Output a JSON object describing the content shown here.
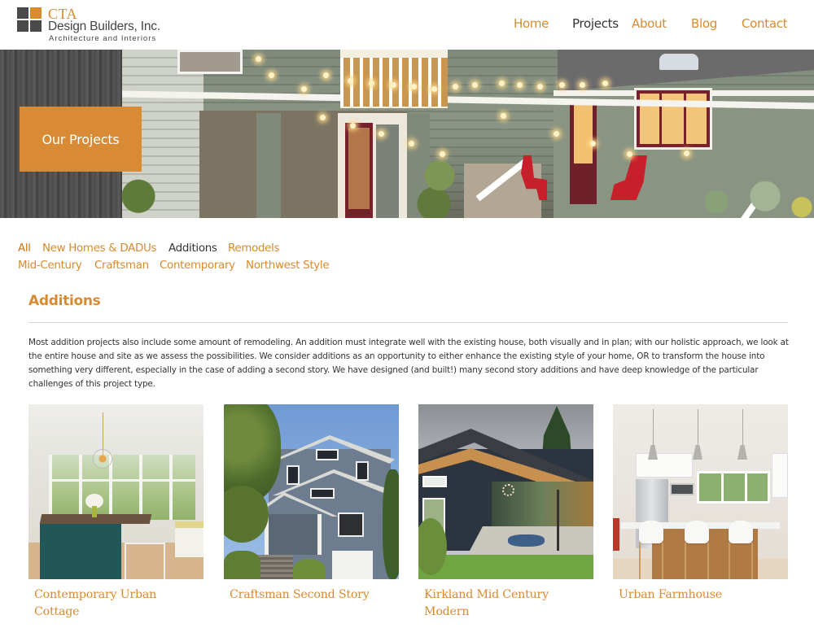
{
  "header": {
    "logo": {
      "brand": "CTA",
      "name": "Design Builders, Inc.",
      "tagline": "Architecture and Interiors"
    },
    "nav": [
      {
        "label": "Home",
        "active": false
      },
      {
        "label": "Projects",
        "active": true
      },
      {
        "label": "About",
        "active": false
      },
      {
        "label": "Blog",
        "active": false
      },
      {
        "label": "Contact",
        "active": false
      }
    ]
  },
  "hero": {
    "badge_label": "Our Projects"
  },
  "filters": {
    "row1": [
      {
        "label": "All"
      },
      {
        "label": "New Homes & DADUs"
      },
      {
        "label": "Additions",
        "current": true
      },
      {
        "label": "Remodels"
      }
    ],
    "row2": [
      {
        "label": "Mid-Century"
      },
      {
        "label": "Craftsman"
      },
      {
        "label": "Contemporary"
      },
      {
        "label": "Northwest Style"
      }
    ]
  },
  "section": {
    "title": "Additions",
    "description": "Most addition projects also include some amount of remodeling. An addition must integrate well with the existing house, both visually and in plan; with our holistic approach, we look at the entire house and site as we assess the possibilities. We consider additions as an opportunity to either enhance the existing style of your home, OR to transform the house into something very different, especially in the case of adding a second story. We have designed (and built!) many second story additions and have deep knowledge of the particular challenges of this project type."
  },
  "projects": [
    {
      "title": "Contemporary Urban Cottage",
      "image": "kitchen-nook-photo"
    },
    {
      "title": "Craftsman Second Story",
      "image": "craftsman-house-photo"
    },
    {
      "title": "Kirkland Mid Century Modern",
      "image": "mid-century-house-photo"
    },
    {
      "title": "Urban Farmhouse",
      "image": "farmhouse-kitchen-photo"
    }
  ],
  "colors": {
    "accent": "#d98a2e",
    "badge": "#d98a35",
    "text": "#333333",
    "logo_dark": "#4a4a4c",
    "divider": "#d7d7d7"
  }
}
